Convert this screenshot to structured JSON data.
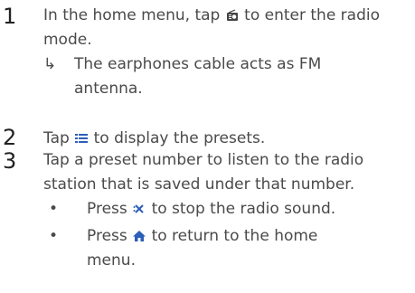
{
  "steps": [
    {
      "number": "1",
      "text_before": "In the home menu, tap",
      "icon": "radio-icon",
      "text_after": "to enter the radio mode.",
      "result": "The earphones cable acts as FM antenna."
    },
    {
      "number": "2",
      "text_before": "Tap",
      "icon": "presets-list-icon",
      "text_after": "to display the presets."
    },
    {
      "number": "3",
      "text": "Tap a preset number to listen to the radio station that is saved under that number.",
      "bullets": [
        {
          "text_before": "Press",
          "icon": "mute-icon",
          "text_after": "to stop the radio sound."
        },
        {
          "text_before": "Press",
          "icon": "home-icon",
          "text_after": "to return to the home menu."
        }
      ]
    }
  ],
  "symbols": {
    "result_arrow": "↳",
    "bullet": "•"
  },
  "colors": {
    "text": "#4a4a4a",
    "step_number": "#222222",
    "accent_blue": "#2b5fb8"
  }
}
